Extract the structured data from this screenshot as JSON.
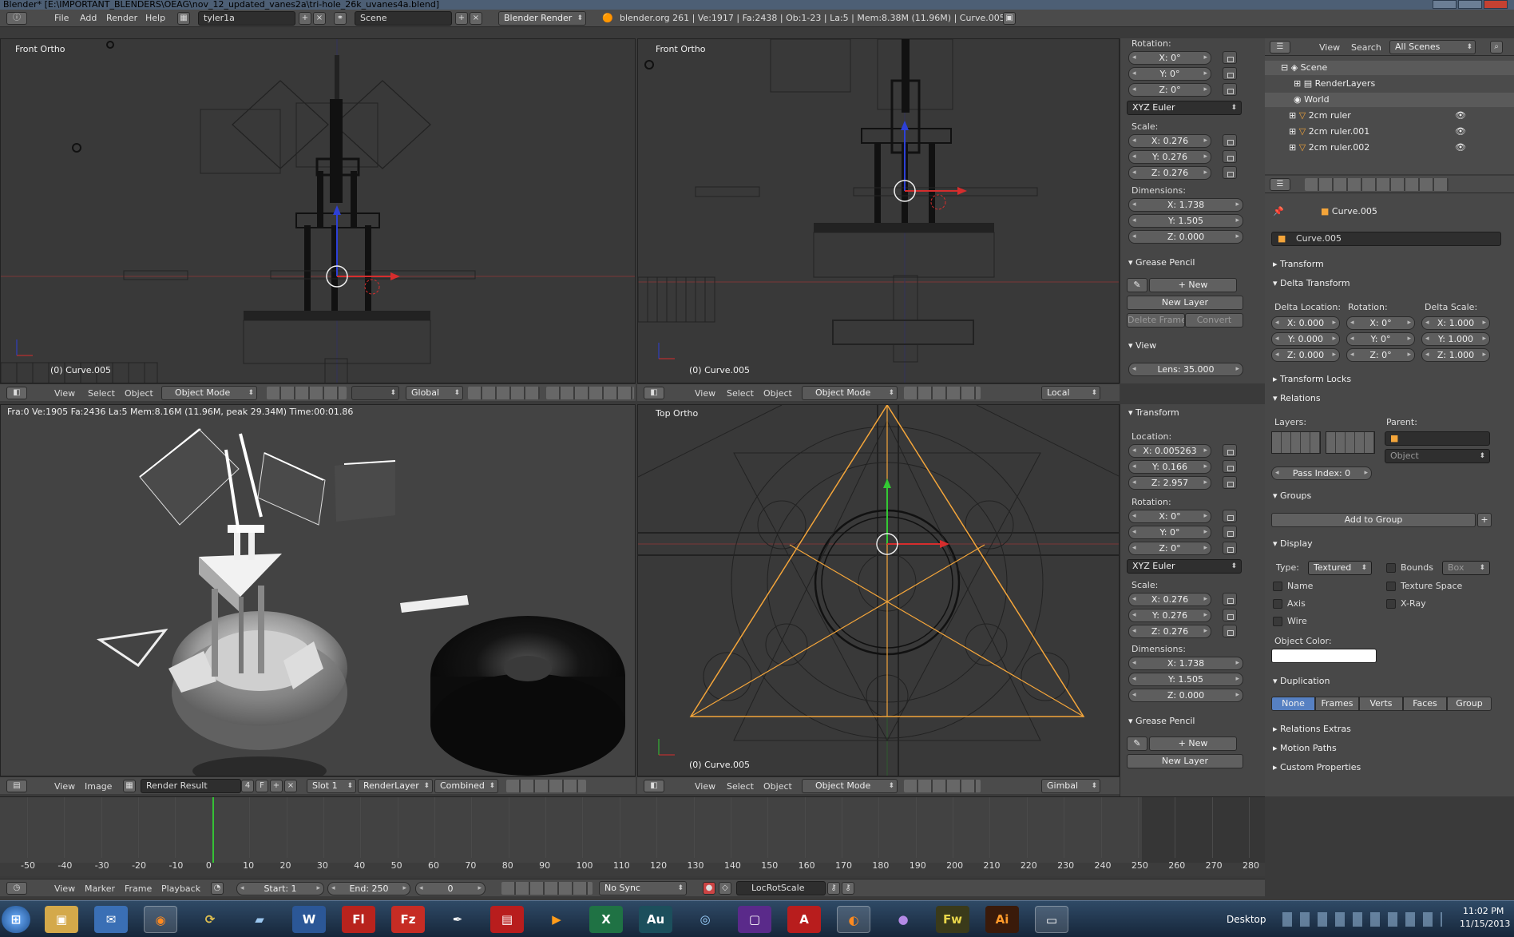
{
  "window": {
    "title": "Blender* [E:\\IMPORTANT_BLENDERS\\OEAG\\nov_12_updated_vanes2a\\tri-hole_26k_uvanes4a.blend]"
  },
  "topbar": {
    "menus": [
      "File",
      "Add",
      "Render",
      "Help"
    ],
    "screen_layout": "tyler1a",
    "scene": "Scene",
    "render_engine": "Blender Render",
    "stats": "blender.org 261 | Ve:1917 | Fa:2438 | Ob:1-23 | La:5 | Mem:8.38M (11.96M) | Curve.005"
  },
  "viewports": {
    "top_left": {
      "label": "Front Ortho",
      "object_label": "(0) Curve.005",
      "header": {
        "menus": [
          "View",
          "Select",
          "Object"
        ],
        "mode": "Object Mode",
        "orientation": "Global"
      }
    },
    "top_right": {
      "label": "Front Ortho",
      "object_label": "(0) Curve.005",
      "header": {
        "menus": [
          "View",
          "Select",
          "Object"
        ],
        "mode": "Object Mode",
        "orientation": "Local"
      }
    },
    "bottom_left": {
      "render_info": "Fra:0  Ve:1905 Fa:2436 La:5 Mem:8.16M (11.96M, peak 29.34M) Time:00:01.86",
      "header": {
        "menus": [
          "View",
          "Image"
        ],
        "image": "Render Result",
        "image_users": "4",
        "fake_user": "F",
        "slot": "Slot 1",
        "render_layer": "RenderLayer",
        "pass": "Combined"
      }
    },
    "bottom_right": {
      "label": "Top Ortho",
      "object_label": "(0) Curve.005",
      "header": {
        "menus": [
          "View",
          "Select",
          "Object"
        ],
        "mode": "Object Mode",
        "orientation": "Gimbal"
      }
    }
  },
  "npanel_top": {
    "rotation_label": "Rotation:",
    "rotation": [
      "X: 0°",
      "Y: 0°",
      "Z: 0°"
    ],
    "rotation_mode": "XYZ Euler",
    "scale_label": "Scale:",
    "scale": [
      "X: 0.276",
      "Y: 0.276",
      "Z: 0.276"
    ],
    "dimensions_label": "Dimensions:",
    "dimensions": [
      "X: 1.738",
      "Y: 1.505",
      "Z: 0.000"
    ],
    "grease_pencil": "Grease Pencil",
    "new": "New",
    "new_layer": "New Layer",
    "delete_frame": "Delete Frame",
    "convert": "Convert",
    "view_panel": "View",
    "lens": "Lens: 35.000"
  },
  "npanel_bottom": {
    "transform": "Transform",
    "location_label": "Location:",
    "location": [
      "X: 0.005263",
      "Y: 0.166",
      "Z: 2.957"
    ],
    "rotation_label": "Rotation:",
    "rotation": [
      "X: 0°",
      "Y: 0°",
      "Z: 0°"
    ],
    "rotation_mode": "XYZ Euler",
    "scale_label": "Scale:",
    "scale": [
      "X: 0.276",
      "Y: 0.276",
      "Z: 0.276"
    ],
    "dimensions_label": "Dimensions:",
    "dimensions": [
      "X: 1.738",
      "Y: 1.505",
      "Z: 0.000"
    ],
    "grease_pencil": "Grease Pencil",
    "new": "New",
    "new_layer": "New Layer"
  },
  "outliner": {
    "menus": [
      "View",
      "Search"
    ],
    "filter": "All Scenes",
    "items": [
      {
        "label": "Scene"
      },
      {
        "label": "RenderLayers"
      },
      {
        "label": "World"
      },
      {
        "label": "2cm ruler"
      },
      {
        "label": "2cm ruler.001"
      },
      {
        "label": "2cm ruler.002"
      }
    ]
  },
  "properties": {
    "breadcrumb": "Curve.005",
    "object_name": "Curve.005",
    "panels": {
      "transform": "Transform",
      "delta_transform": "Delta Transform",
      "delta_location_label": "Delta Location:",
      "delta_rotation_label": "Rotation:",
      "delta_scale_label": "Delta Scale:",
      "delta_location": [
        "X: 0.000",
        "Y: 0.000",
        "Z: 0.000"
      ],
      "delta_rotation": [
        "X: 0°",
        "Y: 0°",
        "Z: 0°"
      ],
      "delta_scale": [
        "X: 1.000",
        "Y: 1.000",
        "Z: 1.000"
      ],
      "transform_locks": "Transform Locks",
      "relations": "Relations",
      "layers_label": "Layers:",
      "parent_label": "Parent:",
      "parent_type": "Object",
      "pass_index": "Pass Index: 0",
      "groups": "Groups",
      "add_to_group": "Add to Group",
      "display": "Display",
      "type_label": "Type:",
      "display_type": "Textured",
      "bounds": "Bounds",
      "bounds_type": "Box",
      "name": "Name",
      "texture_space": "Texture Space",
      "axis": "Axis",
      "xray": "X-Ray",
      "wire": "Wire",
      "object_color_label": "Object Color:",
      "duplication": "Duplication",
      "dup_tabs": [
        "None",
        "Frames",
        "Verts",
        "Faces",
        "Group"
      ],
      "relations_extras": "Relations Extras",
      "motion_paths": "Motion Paths",
      "custom_properties": "Custom Properties"
    }
  },
  "timeline": {
    "ticks": [
      "-50",
      "-40",
      "-30",
      "-20",
      "-10",
      "0",
      "10",
      "20",
      "30",
      "40",
      "50",
      "60",
      "70",
      "80",
      "90",
      "100",
      "110",
      "120",
      "130",
      "140",
      "150",
      "160",
      "170",
      "180",
      "190",
      "200",
      "210",
      "220",
      "230",
      "240",
      "250",
      "260",
      "270",
      "280"
    ],
    "current_frame": 0,
    "menus": [
      "View",
      "Marker",
      "Frame",
      "Playback"
    ],
    "start": "Start: 1",
    "end": "End: 250",
    "frame": "0",
    "sync": "No Sync",
    "keying_set": "LocRotScale"
  },
  "taskbar": {
    "apps": [
      "start",
      "explorer",
      "thunderbird",
      "firefox",
      "misc",
      "notepad",
      "word",
      "flash",
      "filezilla",
      "inkscape",
      "reader",
      "vlc",
      "excel",
      "audition",
      "browser",
      "app",
      "acrobat",
      "blender",
      "eclipse",
      "fireworks",
      "illustrator",
      "window"
    ],
    "desktop": "Desktop",
    "time": "11:02 PM",
    "date": "11/15/2013"
  },
  "colors": {
    "selection_orange": "#f4a53a",
    "axis_red": "#d62d2d",
    "axis_green": "#33c933",
    "axis_blue": "#2d40d6",
    "playhead_green": "#35c135",
    "active_tab_blue": "#5680c2"
  }
}
